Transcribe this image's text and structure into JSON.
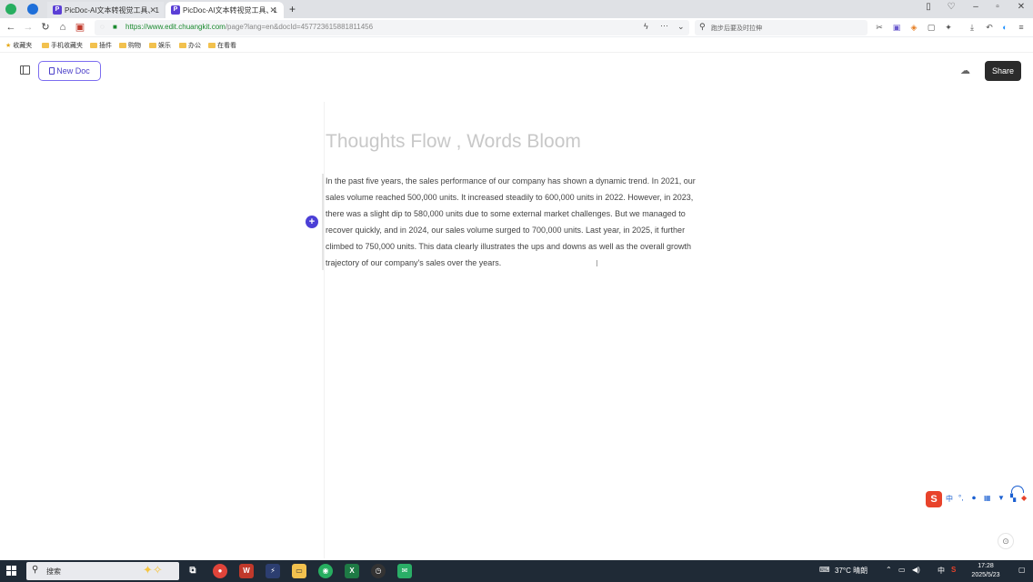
{
  "browser": {
    "tabs": [
      {
        "label": "PicDoc-AI文本转视觉工具、1",
        "active": false
      },
      {
        "label": "PicDoc-AI文本转视觉工具、1",
        "active": true
      }
    ],
    "new_tab_icon": "plus-icon",
    "url_scheme_host": "https://www.edit.chuangkit.com",
    "url_rest": "/page?lang=en&docId=457723615881811456",
    "search_placeholder": "跑步后要及时拉伸",
    "bookmarks": [
      "收藏夹",
      "手机收藏夹",
      "插件",
      "购物",
      "娱乐",
      "办公",
      "在看看"
    ]
  },
  "app": {
    "new_doc_label": "New Doc",
    "share_label": "Share"
  },
  "document": {
    "title": "Thoughts Flow , Words Bloom",
    "body": "In the past five years, the sales performance of our company has shown a dynamic trend. In 2021, our sales volume reached 500,000 units. It increased steadily to 600,000 units in 2022. However, in 2023, there was a slight dip to 580,000 units due to some external market challenges. But we managed to recover quickly, and in 2024, our sales volume surged to 700,000 units. Last year, in 2025, it further climbed to 750,000 units. This data clearly illustrates the ups and downs as well as the overall growth trajectory of our company's sales over the years."
  },
  "ime": {
    "items": [
      "中",
      "°,",
      "🎤",
      "▦",
      "👕",
      "⁂"
    ]
  },
  "taskbar": {
    "search_label": "搜索",
    "weather": "37°C 晴朗",
    "input_lang": "中",
    "time": "17:28",
    "date": "2025/5/23"
  },
  "colors": {
    "accent": "#4b3fd6",
    "share_bg": "#2b2b2b",
    "url_green": "#1b8a2f",
    "taskbar_bg": "#1f2a36"
  }
}
